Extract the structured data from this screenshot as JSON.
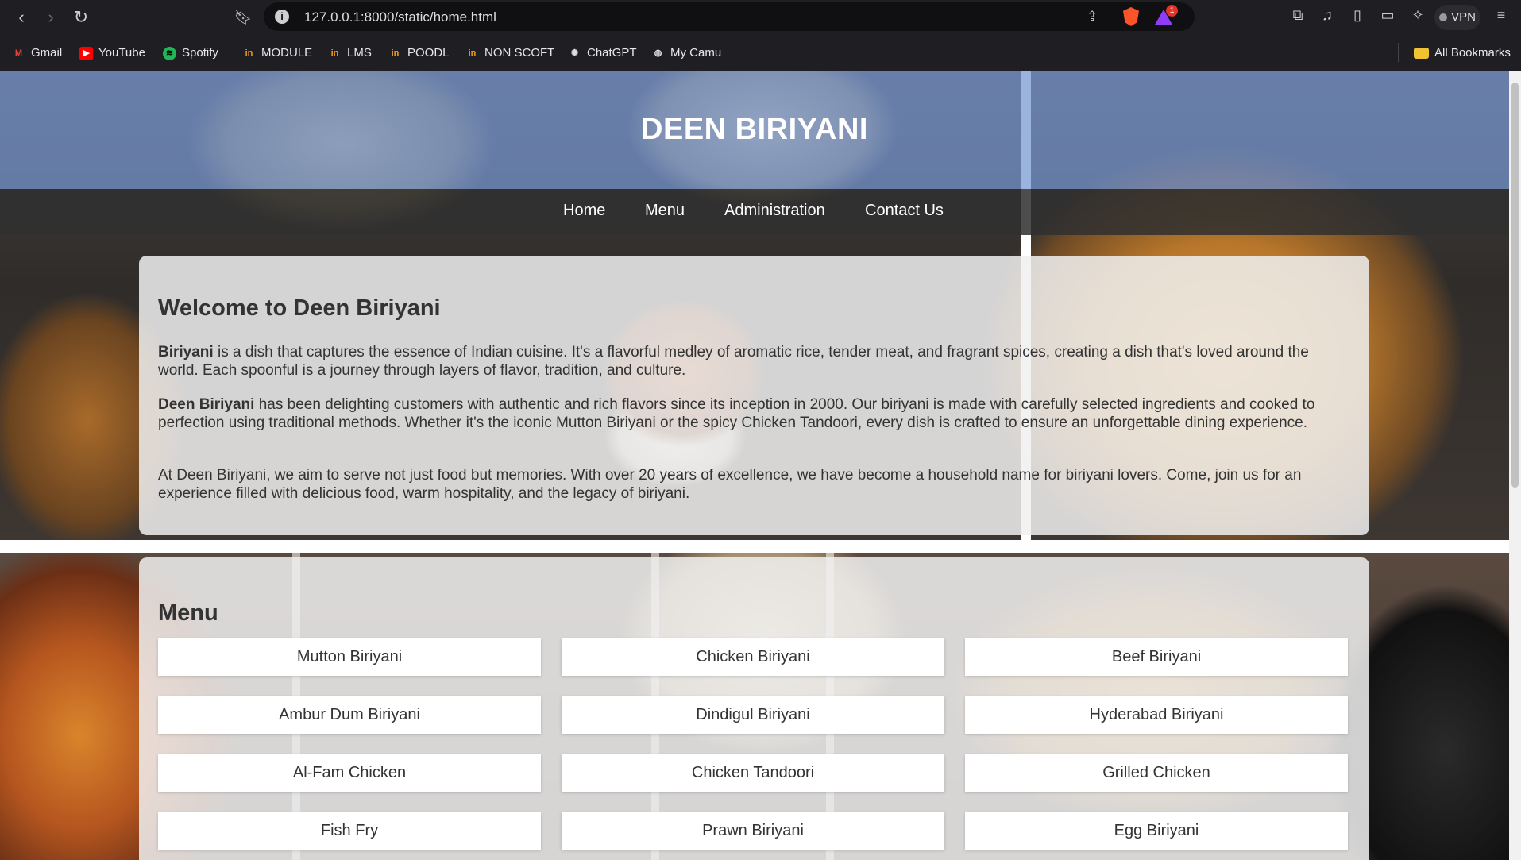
{
  "browser": {
    "url": "127.0.0.1:8000/static/home.html",
    "vpn_label": "VPN",
    "notification_count": "1",
    "bookmarks": [
      {
        "label": "Gmail",
        "icon": "gmail-icon",
        "color": "#ea4335"
      },
      {
        "label": "YouTube",
        "icon": "youtube-icon",
        "color": "#ff0000"
      },
      {
        "label": "Spotify",
        "icon": "spotify-icon",
        "color": "#1db954"
      },
      {
        "label": "MODULE",
        "icon": "lms-icon",
        "color": "#f29b1d"
      },
      {
        "label": "LMS",
        "icon": "lms-icon",
        "color": "#f29b1d"
      },
      {
        "label": "POODL",
        "icon": "lms-icon",
        "color": "#f29b1d"
      },
      {
        "label": "NON SCOFT",
        "icon": "lms-icon",
        "color": "#f29b1d"
      },
      {
        "label": "ChatGPT",
        "icon": "chatgpt-icon",
        "color": "#cccccc"
      },
      {
        "label": "My Camu",
        "icon": "globe-icon",
        "color": "#cccccc"
      }
    ],
    "all_bookmarks": "All Bookmarks"
  },
  "site": {
    "title": "DEEN BIRIYANI",
    "nav": [
      "Home",
      "Menu",
      "Administration",
      "Contact Us"
    ]
  },
  "welcome": {
    "heading": "Welcome to Deen Biriyani",
    "p1_bold": "Biriyani",
    "p1_rest": " is a dish that captures the essence of Indian cuisine. It's a flavorful medley of aromatic rice, tender meat, and fragrant spices, creating a dish that's loved around the world. Each spoonful is a journey through layers of flavor, tradition, and culture.",
    "p2_bold": "Deen Biriyani",
    "p2_rest": " has been delighting customers with authentic and rich flavors since its inception in 2000. Our biriyani is made with carefully selected ingredients and cooked to perfection using traditional methods. Whether it's the iconic Mutton Biriyani or the spicy Chicken Tandoori, every dish is crafted to ensure an unforgettable dining experience.",
    "p3": "At Deen Biriyani, we aim to serve not just food but memories. With over 20 years of excellence, we have become a household name for biriyani lovers. Come, join us for an experience filled with delicious food, warm hospitality, and the legacy of biriyani."
  },
  "menu": {
    "heading": "Menu",
    "items": [
      "Mutton Biriyani",
      "Chicken Biriyani",
      "Beef Biriyani",
      "Ambur Dum Biriyani",
      "Dindigul Biriyani",
      "Hyderabad Biriyani",
      "Al-Fam Chicken",
      "Chicken Tandoori",
      "Grilled Chicken",
      "Fish Fry",
      "Prawn Biriyani",
      "Egg Biriyani"
    ]
  }
}
